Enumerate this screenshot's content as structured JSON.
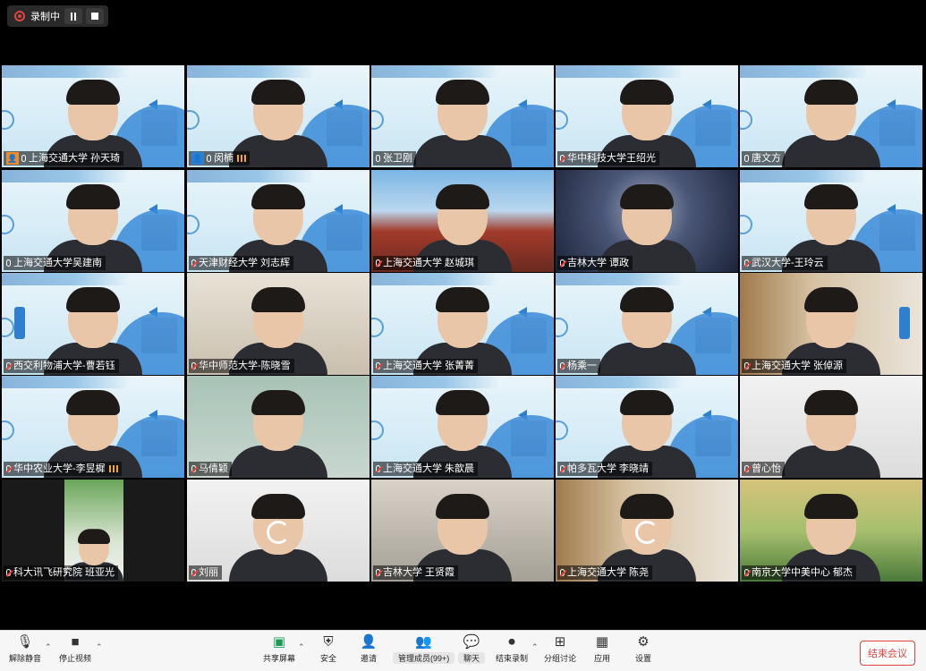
{
  "recording": {
    "label": "录制中"
  },
  "participants": [
    {
      "name": "上海交通大学 孙天琦",
      "row": 0,
      "col": 0,
      "bg": "slide",
      "host": true,
      "signal": false,
      "mic": "on"
    },
    {
      "name": "闵楠",
      "row": 0,
      "col": 1,
      "bg": "slide",
      "user": true,
      "signal": true,
      "mic": "on"
    },
    {
      "name": "张卫刚",
      "row": 0,
      "col": 2,
      "bg": "slide",
      "mic": "on"
    },
    {
      "name": "华中科技大学王绍光",
      "row": 0,
      "col": 3,
      "bg": "slide",
      "mic": "off"
    },
    {
      "name": "唐文方",
      "row": 0,
      "col": 4,
      "bg": "slide",
      "mic": "on"
    },
    {
      "name": "上海交通大学吴建南",
      "row": 1,
      "col": 0,
      "bg": "slide",
      "mic": "on"
    },
    {
      "name": "天津财经大学 刘志辉",
      "row": 1,
      "col": 1,
      "bg": "slide",
      "mic": "off"
    },
    {
      "name": "上海交通大学 赵城琪",
      "row": 1,
      "col": 2,
      "bg": "temple",
      "mic": "off"
    },
    {
      "name": "吉林大学 谭政",
      "row": 1,
      "col": 3,
      "bg": "stars",
      "mic": "off"
    },
    {
      "name": "武汉大学-王玲云",
      "row": 1,
      "col": 4,
      "bg": "slide",
      "mic": "off"
    },
    {
      "name": "西交利物浦大学-曹若钰",
      "row": 2,
      "col": 0,
      "bg": "slide",
      "mic": "off"
    },
    {
      "name": "华中师范大学-陈晓雪",
      "row": 2,
      "col": 1,
      "bg": "room",
      "mic": "off"
    },
    {
      "name": "上海交通大学 张菁菁",
      "row": 2,
      "col": 2,
      "bg": "slide",
      "mic": "off"
    },
    {
      "name": "杨乘一",
      "row": 2,
      "col": 3,
      "bg": "slide",
      "mic": "off"
    },
    {
      "name": "上海交通大学 张倬源",
      "row": 2,
      "col": 4,
      "bg": "shelf",
      "mic": "off"
    },
    {
      "name": "华中农业大学-李昱樨",
      "row": 3,
      "col": 0,
      "bg": "slide",
      "signal": true,
      "mic": "off"
    },
    {
      "name": "马倩颖",
      "row": 3,
      "col": 1,
      "bg": "blurry",
      "mic": "off"
    },
    {
      "name": "上海交通大学 朱歆晨",
      "row": 3,
      "col": 2,
      "bg": "slide",
      "mic": "off"
    },
    {
      "name": "帕多瓦大学 李晓靖",
      "row": 3,
      "col": 3,
      "bg": "slide",
      "mic": "off"
    },
    {
      "name": "曾心怡",
      "row": 3,
      "col": 4,
      "bg": "white",
      "mic": "off"
    },
    {
      "name": "科大讯飞研究院 班亚光",
      "row": 4,
      "col": 0,
      "bg": "dark",
      "mic": "off"
    },
    {
      "name": "刘丽",
      "row": 4,
      "col": 1,
      "bg": "white",
      "spinner": true,
      "mic": "off"
    },
    {
      "name": "吉林大学 王贤霞",
      "row": 4,
      "col": 2,
      "bg": "office",
      "mic": "off"
    },
    {
      "name": "上海交通大学 陈尧",
      "row": 4,
      "col": 3,
      "bg": "shelf",
      "spinner": true,
      "mic": "off"
    },
    {
      "name": "南京大学中美中心 郁杰",
      "row": 4,
      "col": 4,
      "bg": "landscape",
      "mic": "off"
    }
  ],
  "toolbar": {
    "unmute": "解除静音",
    "stop_video": "停止视频",
    "share_screen": "共享屏幕",
    "security": "安全",
    "invite": "邀请",
    "manage_participants": "管理成员(99+)",
    "chat": "聊天",
    "end_recording": "结束录制",
    "breakout": "分组讨论",
    "apps": "应用",
    "settings": "设置",
    "end_meeting": "结束会议"
  },
  "colors": {
    "accent": "#2f7fcf",
    "danger": "#e0443e",
    "host": "#f08a24"
  }
}
